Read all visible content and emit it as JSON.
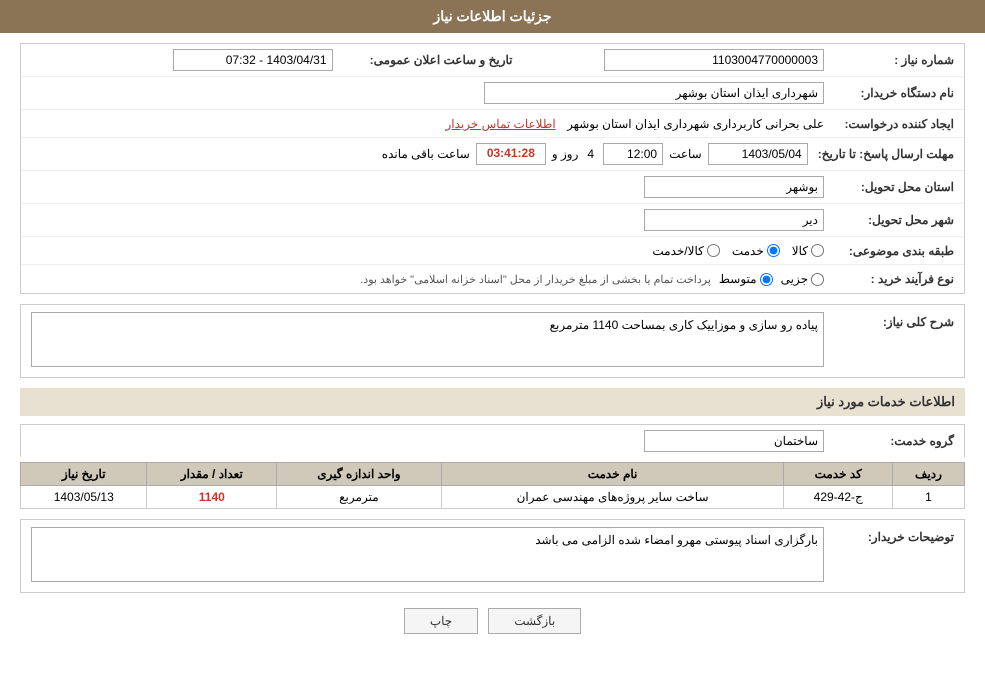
{
  "page": {
    "title": "جزئیات اطلاعات نیاز"
  },
  "fields": {
    "need_number_label": "شماره نیاز :",
    "need_number_value": "1103004770000003",
    "announce_date_label": "تاریخ و ساعت اعلان عمومی:",
    "announce_date_value": "1403/04/31 - 07:32",
    "requester_org_label": "نام دستگاه خریدار:",
    "requester_org_value": "شهرداری ایذان استان بوشهر",
    "creator_label": "ایجاد کننده درخواست:",
    "creator_value": "علی بحرانی کاربرداری شهرداری ایذان استان بوشهر",
    "creator_link": "اطلاعات تماس خریدار",
    "response_date_label": "مهلت ارسال پاسخ: تا تاریخ:",
    "response_date_value": "1403/05/04",
    "response_time_label": "ساعت",
    "response_time_value": "12:00",
    "response_days_label": "روز و",
    "response_days_value": "4",
    "response_remaining_label": "ساعت باقی مانده",
    "response_remaining_value": "03:41:28",
    "province_label": "استان محل تحویل:",
    "province_value": "بوشهر",
    "city_label": "شهر محل تحویل:",
    "city_value": "دیر",
    "category_label": "طبقه بندی موضوعی:",
    "category_options": [
      {
        "id": "kala",
        "label": "کالا"
      },
      {
        "id": "khedmat",
        "label": "خدمت"
      },
      {
        "id": "kala_khedmat",
        "label": "کالا/خدمت"
      }
    ],
    "category_selected": "khedmat",
    "purchase_type_label": "نوع فرآیند خرید :",
    "purchase_type_options": [
      {
        "id": "jozii",
        "label": "جزیی"
      },
      {
        "id": "motavasset",
        "label": "متوسط"
      }
    ],
    "purchase_type_selected": "motavasset",
    "purchase_type_note": "پرداخت تمام یا بخشی از مبلغ خریدار از محل \"اسناد خزانه اسلامی\" خواهد بود.",
    "description_label": "شرح کلی نیاز:",
    "description_value": "پیاده رو سازی و موزاییک کاری بمساحت 1140 مترمربع",
    "services_title": "اطلاعات خدمات مورد نیاز",
    "service_group_label": "گروه خدمت:",
    "service_group_value": "ساختمان",
    "table_headers": {
      "row_num": "ردیف",
      "service_code": "کد خدمت",
      "service_name": "نام خدمت",
      "unit": "واحد اندازه گیری",
      "quantity": "تعداد / مقدار",
      "date": "تاریخ نیاز"
    },
    "table_rows": [
      {
        "row_num": "1",
        "service_code": "ج-42-429",
        "service_name": "ساخت سایر پروژه‌های مهندسی عمران",
        "unit": "مترمربع",
        "quantity": "1140",
        "date": "1403/05/13"
      }
    ],
    "buyer_notes_label": "توضیحات خریدار:",
    "buyer_notes_value": "بارگزاری اسناد پیوستی مهرو امضاء شده الزامی می باشد",
    "btn_back": "بازگشت",
    "btn_print": "چاپ"
  }
}
